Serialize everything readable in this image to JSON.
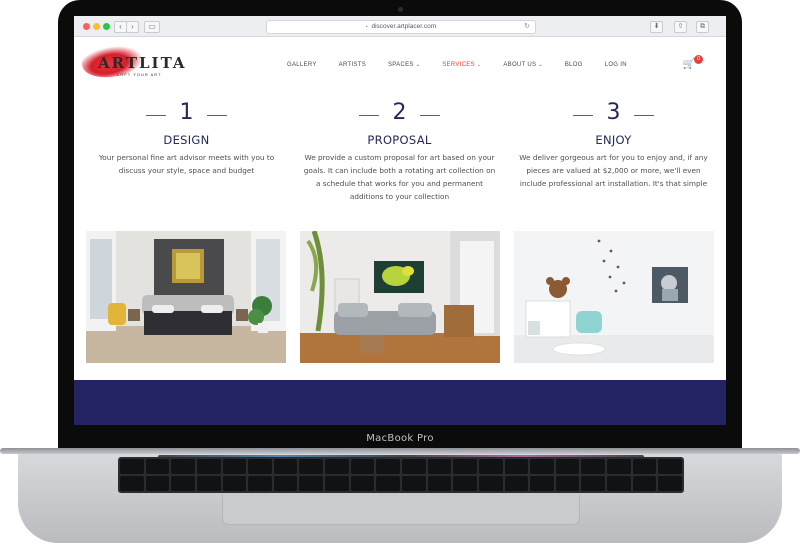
{
  "device": {
    "label": "MacBook Pro"
  },
  "browser": {
    "url": "discover.artplacer.com",
    "back_icon": "‹",
    "forward_icon": "›",
    "reload_icon": "↻"
  },
  "site": {
    "logo_text": "ARTLITA",
    "logo_tagline": "LOFT YOUR ART",
    "menu": [
      {
        "label": "GALLERY",
        "active": false,
        "has_caret": false
      },
      {
        "label": "ARTISTS",
        "active": false,
        "has_caret": false
      },
      {
        "label": "SPACES",
        "active": false,
        "has_caret": true
      },
      {
        "label": "SERVICES",
        "active": true,
        "has_caret": true
      },
      {
        "label": "ABOUT US",
        "active": false,
        "has_caret": true
      },
      {
        "label": "BLOG",
        "active": false,
        "has_caret": false
      },
      {
        "label": "LOG IN",
        "active": false,
        "has_caret": false
      }
    ],
    "cart_count": "0",
    "caret": "⌄"
  },
  "steps": [
    {
      "number": "1",
      "title": "DESIGN",
      "description": "Your personal fine art advisor meets with you to discuss your style, space and budget"
    },
    {
      "number": "2",
      "title": "PROPOSAL",
      "description": "We provide a custom proposal for art based on your goals. It can include both a rotating art collection on a schedule that works for you and permanent additions to your collection"
    },
    {
      "number": "3",
      "title": "ENJOY",
      "description": "We deliver gorgeous art for you to enjoy and, if any pieces are valued at $2,000 or more, we'll even include professional art installation. It's that simple"
    }
  ],
  "colors": {
    "brand_navy": "#242463",
    "accent_red": "#e5413b"
  }
}
